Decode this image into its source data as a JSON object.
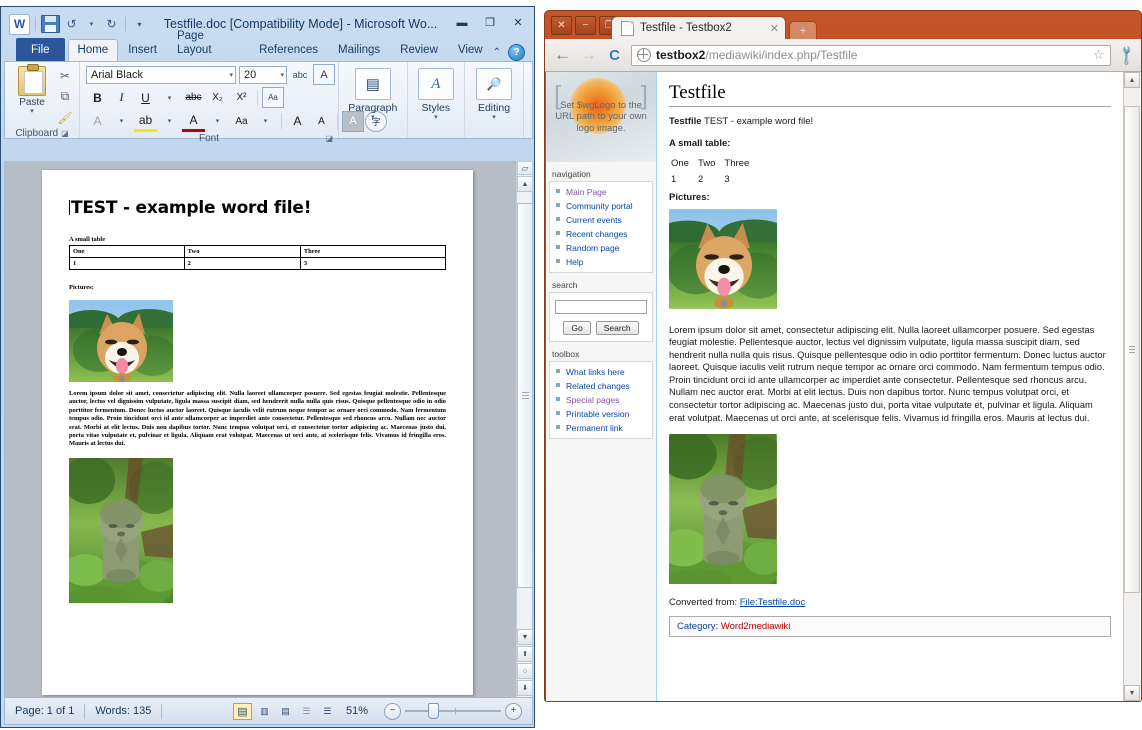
{
  "word": {
    "title": "Testfile.doc [Compatibility Mode]  -  Microsoft Wo...",
    "app_icon": "W",
    "quick_access": [
      {
        "name": "save-icon",
        "glyph": ""
      },
      {
        "name": "undo-icon",
        "glyph": "↺"
      },
      {
        "name": "undo-dropdown-icon",
        "glyph": "▾"
      },
      {
        "name": "redo-icon",
        "glyph": "↻"
      },
      {
        "name": "customize-qat-icon",
        "glyph": "▾"
      }
    ],
    "window_controls": [
      {
        "name": "minimize-button",
        "glyph": "▬"
      },
      {
        "name": "restore-button",
        "glyph": "❐"
      },
      {
        "name": "close-button",
        "glyph": "✕"
      }
    ],
    "tabs": [
      {
        "label": "File",
        "active": false,
        "file": true
      },
      {
        "label": "Home",
        "active": true
      },
      {
        "label": "Insert",
        "active": false
      },
      {
        "label": "Page Layout",
        "active": false
      },
      {
        "label": "References",
        "active": false
      },
      {
        "label": "Mailings",
        "active": false
      },
      {
        "label": "Review",
        "active": false
      },
      {
        "label": "View",
        "active": false
      }
    ],
    "ribbon_collapse_icon": "⌃",
    "help_icon": "?",
    "clipboard": {
      "group_label": "Clipboard",
      "paste_label": "Paste",
      "paste_caret": "▾",
      "cut_icon": "✂",
      "copy_icon": "⧉",
      "format_painter_icon": "🖌",
      "dialog_launcher": "◪"
    },
    "font": {
      "group_label": "Font",
      "font_name": "Arial Black",
      "font_size": "20",
      "grow_font": "A",
      "shrink_font": "A",
      "change_case": "Aa",
      "clear_formatting": "A",
      "text_effects": "A",
      "bold": "B",
      "italic": "I",
      "underline": "U",
      "strikethrough": "abc",
      "subscript": "X₂",
      "superscript": "X²",
      "highlight": "ab",
      "font_color": "A",
      "phonetic_guide": "字",
      "character_border": "A",
      "dialog_launcher": "◪"
    },
    "paragraph": {
      "label": "Paragraph",
      "caret": "▾",
      "icon": "▤"
    },
    "styles": {
      "label": "Styles",
      "caret": "▾",
      "icon": "A"
    },
    "editing": {
      "label": "Editing",
      "caret": "▾",
      "icon": "🔍"
    },
    "document": {
      "heading": "TEST - example word file!",
      "table_intro": "A small table",
      "table": [
        [
          "One",
          "Two",
          "Three"
        ],
        [
          "1",
          "2",
          "3"
        ]
      ],
      "pictures_label": "Pictures:",
      "paragraph": "Lorem ipsum dolor sit amet, consectetur adipiscing elit. Nulla laoreet ullamcorper posuere. Sed egestas feugiat molestie. Pellentesque auctor, lectus vel dignissim vulputate, ligula massa suscipit diam, sed hendrerit nulla nulla quis risus. Quisque pellentesque odio in odio porttitor fermentum. Donec luctus auctor laoreet. Quisque iaculis velit rutrum neque tempor ac ornare orci commodo. Nam fermentum tempus odio. Proin tincidunt orci id ante ullamcorper ac imperdiet ante consectetur. Pellentesque sed rhoncus arcu. Nullam nec auctor erat. Morbi at elit lectus. Duis non dapibus tortor. Nunc tempus volutpat orci, et consectetur tortor adipiscing ac. Maecenas justo dui, porta vitae vulputate et, pulvinar et ligula. Aliquam erat volutpat. Maecenas ut orci ante, at scelerisque felis. Vivamus id fringilla eros. Mauris at lectus dui."
    },
    "status": {
      "page": "Page: 1 of 1",
      "words": "Words: 135",
      "zoom": "51%",
      "zoom_out_icon": "−",
      "zoom_in_icon": "+",
      "views": [
        {
          "name": "print-layout-view",
          "glyph": "▤",
          "active": true
        },
        {
          "name": "full-screen-reading-view",
          "glyph": "📖",
          "active": false
        },
        {
          "name": "web-layout-view",
          "glyph": "🖹",
          "active": false
        },
        {
          "name": "outline-view",
          "glyph": "▥",
          "active": false
        },
        {
          "name": "draft-view",
          "glyph": "▤",
          "active": false
        }
      ]
    },
    "scrollbar": {
      "split_icon": "▱",
      "up_icon": "▲",
      "down_icon": "▼",
      "prev_page_icon": "⬆",
      "select_browse_object_icon": "○",
      "next_page_icon": "⬇"
    }
  },
  "chrome": {
    "window_controls": [
      {
        "name": "close-button",
        "glyph": "✕"
      },
      {
        "name": "minimize-button",
        "glyph": "−"
      },
      {
        "name": "maximize-button",
        "glyph": "❐"
      }
    ],
    "tab": {
      "title": "Testfile - Testbox2",
      "close_glyph": "✕"
    },
    "new_tab_glyph": "+",
    "nav": {
      "back_icon": "←",
      "forward_icon": "→",
      "reload_icon": "C",
      "bookmark_icon": "☆",
      "menu_icon": "🔧"
    },
    "url_bold": "testbox2",
    "url_rest": "/mediawiki/index.php/Testfile",
    "scrollbar": {
      "up_icon": "▲",
      "down_icon": "▼"
    }
  },
  "wiki": {
    "logo_text": "Set $wgLogo to the URL path to your own logo image.",
    "bracket_left": "[",
    "bracket_right": "]",
    "navigation": {
      "title": "navigation",
      "items": [
        {
          "label": "Main Page",
          "visited": true
        },
        {
          "label": "Community portal",
          "visited": false
        },
        {
          "label": "Current events",
          "visited": false
        },
        {
          "label": "Recent changes",
          "visited": false
        },
        {
          "label": "Random page",
          "visited": false
        },
        {
          "label": "Help",
          "visited": false
        }
      ]
    },
    "search": {
      "title": "search",
      "value": "",
      "go_label": "Go",
      "search_label": "Search"
    },
    "toolbox": {
      "title": "toolbox",
      "items": [
        {
          "label": "What links here",
          "visited": false
        },
        {
          "label": "Related changes",
          "visited": false
        },
        {
          "label": "Special pages",
          "visited": true
        },
        {
          "label": "Printable version",
          "visited": false
        },
        {
          "label": "Permanent link",
          "visited": false
        }
      ]
    },
    "page_title": "Testfile",
    "lead_bold": "Testfile",
    "lead_rest": " TEST - example word file!",
    "table_heading": "A small table:",
    "table": [
      [
        "One",
        "Two",
        "Three"
      ],
      [
        "1",
        "2",
        "3"
      ]
    ],
    "pictures_heading": "Pictures:",
    "body_paragraph": "Lorem ipsum dolor sit amet, consectetur adipiscing elit. Nulla laoreet ullamcorper posuere. Sed egestas feugiat molestie. Pellentesque auctor, lectus vel dignissim vulputate, ligula massa suscipit diam, sed hendrerit nulla nulla quis risus. Quisque pellentesque odio in odio porttitor fermentum. Donec luctus auctor laoreet. Quisque iaculis velit rutrum neque tempor ac ornare orci commodo. Nam fermentum tempus odio. Proin tincidunt orci id ante ullamcorper ac imperdiet ante consectetur. Pellentesque sed rhoncus arcu. Nullam nec auctor erat. Morbi at elit lectus. Duis non dapibus tortor. Nunc tempus volutpat orci, et consectetur tortor adipiscing ac. Maecenas justo dui, porta vitae vulputate et, pulvinar et ligula. Aliquam erat volutpat. Maecenas ut orci ante, at scelerisque felis. Vivamus id fringilla eros. Mauris at lectus dui.",
    "converted_label": "Converted from: ",
    "converted_link": "File:Testfile.doc",
    "category_label": "Category",
    "category_sep": ": ",
    "category_value": "Word2mediawiki",
    "image_dog_alt": "smiling shiba inu dog in a green field",
    "image_statue_alt": "mossy stone jizo statue"
  },
  "colors": {
    "word_accent": "#2b579a",
    "chrome_frame": "#a8431f",
    "wiki_link": "#0645ad",
    "wiki_link_visited": "#8a4fa8",
    "wiki_link_new": "#ba0000"
  }
}
